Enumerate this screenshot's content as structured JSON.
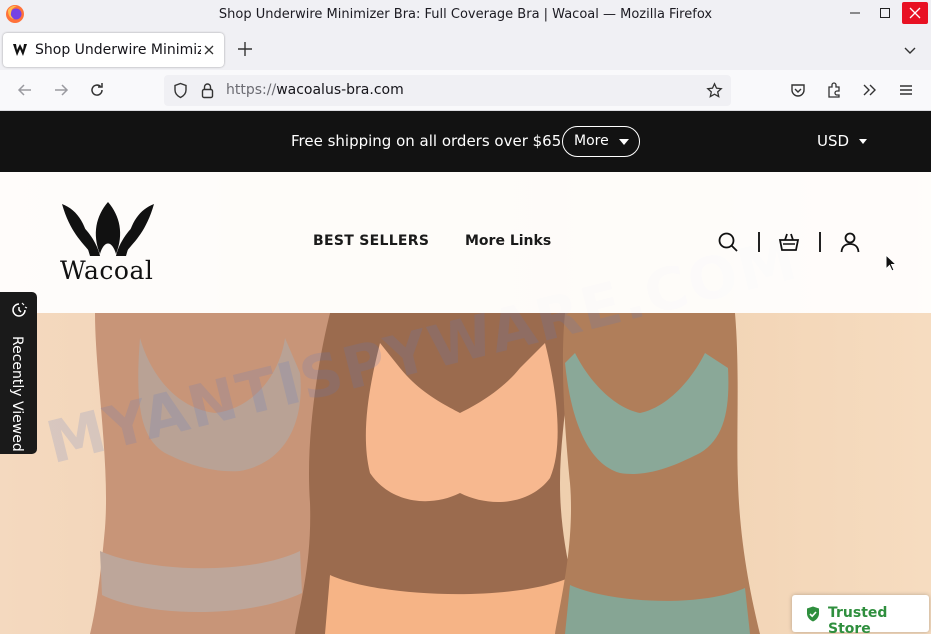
{
  "window": {
    "title": "Shop Underwire Minimizer Bra: Full Coverage Bra | Wacoal — Mozilla Firefox"
  },
  "tabs": [
    {
      "label": "Shop Underwire Minimizer Bra: Full Coverage Bra | Wacoal"
    }
  ],
  "addressbar": {
    "scheme": "https://",
    "host": "wacoalus-bra.com"
  },
  "promo": {
    "text": "Free shipping on all orders over $65",
    "more_label": "More",
    "currency": "USD"
  },
  "header": {
    "brand": "Wacoal",
    "nav": [
      "BEST SELLERS",
      "More Links"
    ]
  },
  "sidebar_widget": {
    "label": "Recently Viewed"
  },
  "badge": {
    "label": "Trusted Store",
    "color": "#2f8f3e"
  },
  "watermark": "MYANTISPYWARE.COM",
  "colors": {
    "promo_bg": "#121212",
    "close_button": "#e81123"
  }
}
